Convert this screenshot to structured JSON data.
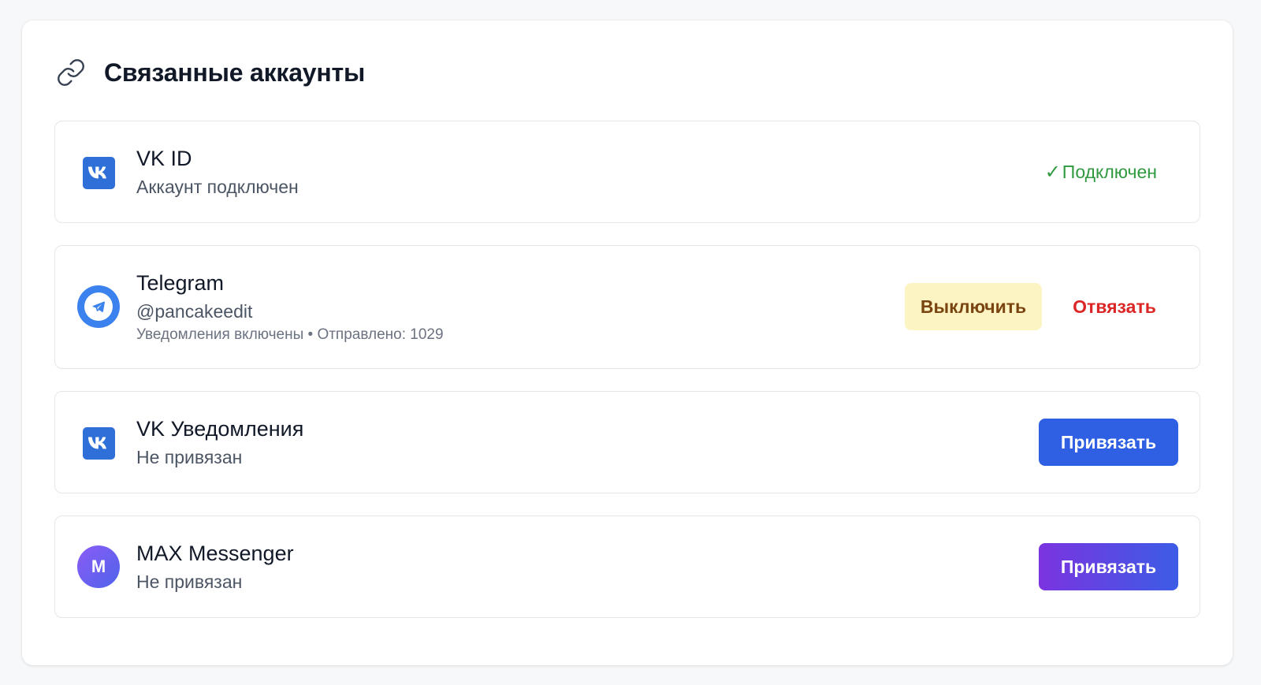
{
  "header": {
    "title": "Связанные аккаунты",
    "icon": "link-icon"
  },
  "accounts": [
    {
      "name": "VK ID",
      "status_text": "Аккаунт подключен",
      "icon": "vk-logo-icon",
      "state_label": "Подключен",
      "state_check": "✓",
      "state_color": "#2f9a3f"
    },
    {
      "name": "Telegram",
      "handle": "@pancakeedit",
      "meta": "Уведомления включены • Отправлено: 1029",
      "icon": "telegram-logo-icon",
      "disable_label": "Выключить",
      "unlink_label": "Отвязать"
    },
    {
      "name": "VK Уведомления",
      "status_text": "Не привязан",
      "icon": "vk-logo-icon",
      "bind_label": "Привязать",
      "bind_color": "#2f5fe3"
    },
    {
      "name": "MAX Messenger",
      "status_text": "Не привязан",
      "icon": "max-logo-icon",
      "logo_letter": "M",
      "bind_label": "Привязать"
    }
  ],
  "colors": {
    "accent_blue": "#2f5fe3",
    "danger": "#dc2626",
    "warning_bg": "#fdf4c4",
    "success": "#2f9a3f",
    "max_gradient_start": "#7b34e0",
    "max_gradient_end": "#3c5ce6"
  }
}
